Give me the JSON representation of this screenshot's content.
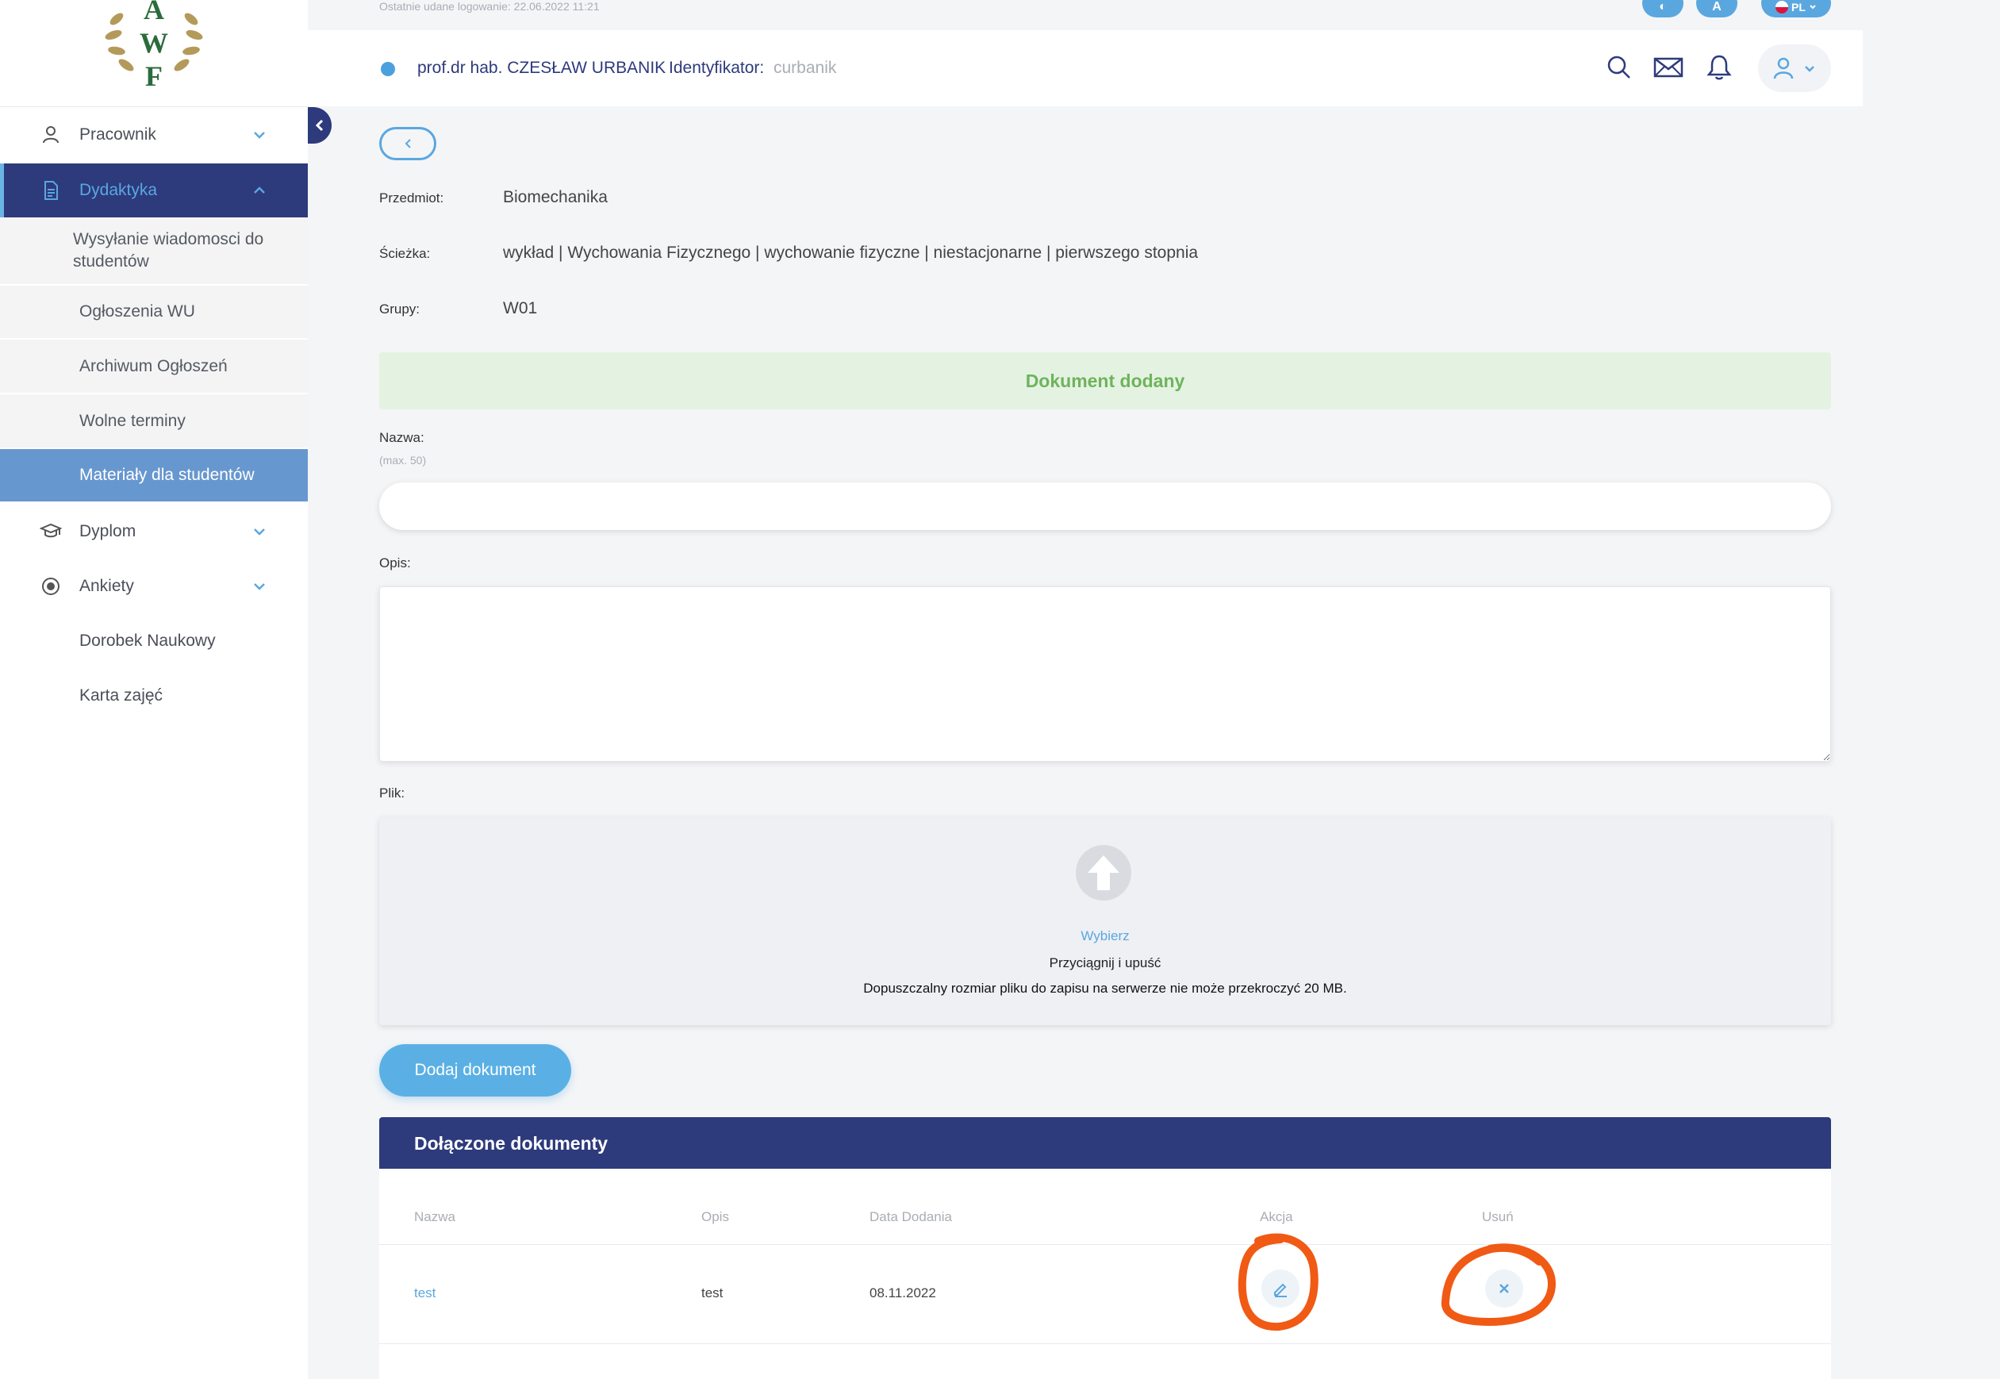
{
  "last_login": "Ostatnie udane logowanie: 22.06.2022 11:21",
  "top_controls": {
    "contrast_label": "◐",
    "font_label": "A",
    "language_label": "PL"
  },
  "header": {
    "user_name": "prof.dr hab. CZESŁAW URBANIK",
    "id_label": "Identyfikator:",
    "id_value": "curbanik",
    "status_color": "#4da0de"
  },
  "sidebar": {
    "logo_letters": [
      "A",
      "W",
      "F"
    ],
    "items": [
      {
        "label": "Pracownik",
        "icon": "user-icon"
      },
      {
        "label": "Dydaktyka",
        "icon": "document-icon",
        "active": true
      },
      {
        "label": "Dyplom",
        "icon": "graduation-cap-icon"
      },
      {
        "label": "Ankiety",
        "icon": "radio-target-icon"
      },
      {
        "label": "Dorobek Naukowy"
      },
      {
        "label": "Karta zajęć"
      }
    ],
    "subitems": [
      {
        "label": "Wysyłanie wiadomosci do studentów"
      },
      {
        "label": "Ogłoszenia WU"
      },
      {
        "label": "Archiwum Ogłoszeń"
      },
      {
        "label": "Wolne terminy"
      },
      {
        "label": "Materiały dla studentów",
        "selected": true
      }
    ]
  },
  "details": {
    "subject_label": "Przedmiot:",
    "subject_value": "Biomechanika",
    "path_label": "Ścieżka:",
    "path_value": "wykład | Wychowania Fizycznego | wychowanie fizyczne | niestacjonarne | pierwszego stopnia",
    "groups_label": "Grupy:",
    "groups_value": "W01"
  },
  "alert": {
    "text": "Dokument dodany"
  },
  "form": {
    "name_label": "Nazwa:",
    "name_hint": "(max. 50)",
    "name_value": "",
    "desc_label": "Opis:",
    "desc_value": "",
    "file_label": "Plik:",
    "choose_label": "Wybierz",
    "drag_label": "Przyciągnij i upuść",
    "limit_text": "Dopuszczalny rozmiar pliku do zapisu na serwerze nie może przekroczyć 20 MB.",
    "submit_label": "Dodaj dokument"
  },
  "documents": {
    "title": "Dołączone dokumenty",
    "columns": [
      "Nazwa",
      "Opis",
      "Data Dodania",
      "Akcja",
      "Usuń"
    ],
    "rows": [
      {
        "name": "test",
        "description": "test",
        "date": "08.11.2022"
      }
    ]
  },
  "colors": {
    "navy": "#2d3a7c",
    "accent": "#5aa7e0",
    "success_bg": "#e4f3e1",
    "success_text": "#6fb35d",
    "annotation": "#f05a14"
  }
}
